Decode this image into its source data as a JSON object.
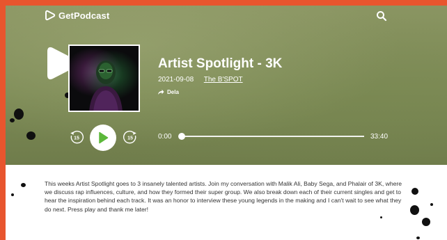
{
  "brand": {
    "name": "GetPodcast"
  },
  "episode": {
    "title": "Artist Spotlight - 3K",
    "date": "2021-09-08",
    "show": "The B'SPOT",
    "share_label": "Dela",
    "description": "This weeks Artist Spotlight goes to 3 insanely talented artists. Join my conversation with Malik Ali, Baby Sega, and Phalair of 3K, where we discuss rap influences, culture, and how they formed their super group. We also break down each of their current singles and get to hear the inspiration behind each track. It was an honor to interview these young legends in the making and I can't wait to see what they do next. Press play and thank me later!"
  },
  "player": {
    "current_time": "0:00",
    "duration": "33:40",
    "progress": 0,
    "rewind_seconds": "15",
    "forward_seconds": "15"
  },
  "colors": {
    "accent_orange": "#e8552e",
    "play_green": "#5cb83a",
    "hero_olive": "#7c8a55"
  },
  "icons": {
    "logo": "play-logo-icon",
    "search": "search-icon",
    "share": "share-arrow-icon",
    "rewind": "rewind-15-icon",
    "play": "play-icon",
    "forward": "forward-15-icon"
  }
}
